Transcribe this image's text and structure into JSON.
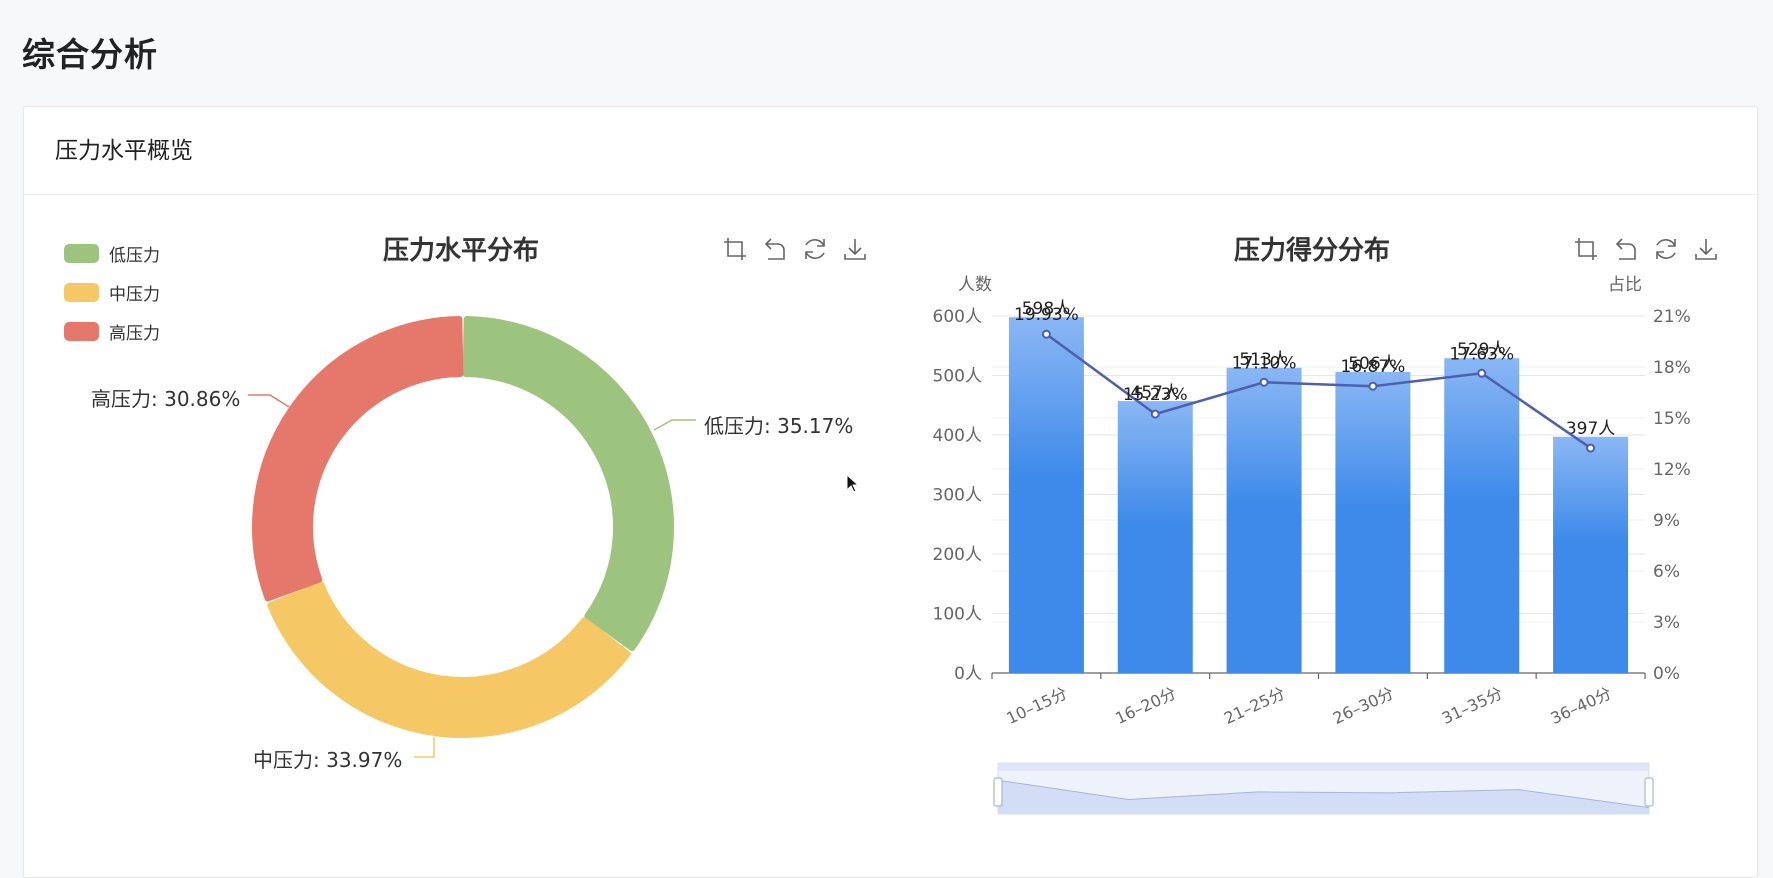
{
  "page": {
    "title": "综合分析"
  },
  "card": {
    "title": "压力水平概览"
  },
  "colors": {
    "low": "#9cc47f",
    "mid": "#f5c865",
    "high": "#e5786a",
    "bar_top": "#8ab7f4",
    "bar_bottom": "#3d8aea",
    "line": "#4d5fae"
  },
  "toolbox": [
    "crop-icon",
    "undo-icon",
    "refresh-icon",
    "download-icon"
  ],
  "chart_data": [
    {
      "type": "pie",
      "title": "压力水平分布",
      "legend": [
        "低压力",
        "中压力",
        "高压力"
      ],
      "slices": [
        {
          "name": "低压力",
          "value": 35.17,
          "label": "低压力: 35.17%"
        },
        {
          "name": "中压力",
          "value": 33.97,
          "label": "中压力: 33.97%"
        },
        {
          "name": "高压力",
          "value": 30.86,
          "label": "高压力: 30.86%"
        }
      ],
      "legend_position": "top-left"
    },
    {
      "type": "bar",
      "title": "压力得分分布",
      "categories": [
        "10–15分",
        "16–20分",
        "21–25分",
        "26–30分",
        "31–35分",
        "36–40分"
      ],
      "ylabel_left": "人数",
      "ylabel_right": "占比",
      "ylim_left": [
        0,
        600
      ],
      "yticks_left": [
        "0人",
        "100人",
        "200人",
        "300人",
        "400人",
        "500人",
        "600人"
      ],
      "ylim_right": [
        0,
        21
      ],
      "yticks_right": [
        "0%",
        "3%",
        "6%",
        "9%",
        "12%",
        "15%",
        "18%",
        "21%"
      ],
      "series": [
        {
          "type": "bar",
          "values": [
            598,
            457,
            513,
            506,
            529,
            397
          ],
          "labels": [
            "598人",
            "457人",
            "513人",
            "506人",
            "529人",
            "397人"
          ]
        },
        {
          "type": "line",
          "values": [
            19.93,
            15.23,
            17.1,
            16.87,
            17.63,
            13.23
          ],
          "labels": [
            "19.93%",
            "15.23%",
            "17.10%",
            "16.87%",
            "17.63%",
            ""
          ]
        }
      ],
      "grid": true,
      "datazoom": {
        "start": 0,
        "end": 100
      }
    }
  ]
}
